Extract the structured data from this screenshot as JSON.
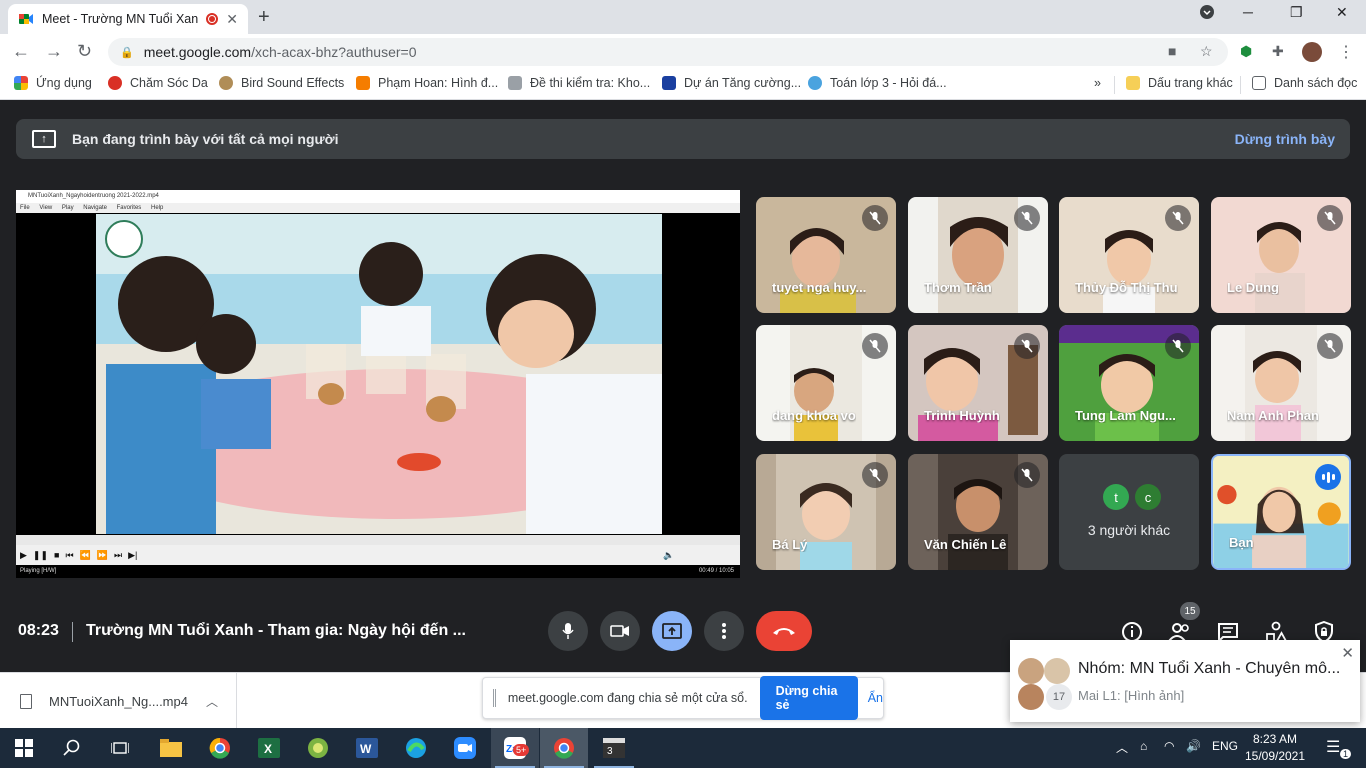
{
  "browser": {
    "tab_title": "Meet - Trường MN Tuổi Xanh",
    "url_host": "meet.google.com",
    "url_path": "/xch-acax-bhz?authuser=0",
    "bookmarks": [
      {
        "label": "Ứng dụng"
      },
      {
        "label": "Chăm Sóc Da"
      },
      {
        "label": "Bird Sound Effects"
      },
      {
        "label": "Phạm Hoan: Hình đ..."
      },
      {
        "label": "Đề thi kiểm tra: Kho..."
      },
      {
        "label": "Dự án Tăng cường..."
      },
      {
        "label": "Toán lớp 3 - Hỏi đá..."
      },
      {
        "label": "»"
      },
      {
        "label": "Dấu trang khác"
      },
      {
        "label": "Danh sách đọc"
      }
    ]
  },
  "meet": {
    "banner_text": "Bạn đang trình bày với tất cả mọi người",
    "stop_label": "Dừng trình bày",
    "time": "08:23",
    "meeting_title": "Trường MN Tuổi Xanh - Tham gia: Ngày hội đến ...",
    "participant_count": "15",
    "player": {
      "window_title": "MNTuoiXanh_Ngayhoidentruong 2021-2022.mp4",
      "menu": [
        "File",
        "View",
        "Play",
        "Navigate",
        "Favorites",
        "Help"
      ],
      "status": "Playing [H/W]",
      "timecode": "00:49 / 10:05"
    },
    "participants": [
      {
        "name": "tuyet nga huy...",
        "bg": "#c9b79c",
        "skin": "#e6b89a"
      },
      {
        "name": "Thơm Trần",
        "bg": "#f2f2ef",
        "skin": "#d9a27f"
      },
      {
        "name": "Thủy Đỗ Thị Thu",
        "bg": "#e8dccc",
        "skin": "#f0c8a8"
      },
      {
        "name": "Le Dung",
        "bg": "#f2d9d2",
        "skin": "#eac0a0"
      },
      {
        "name": "dang khoa vo",
        "bg": "#f4f4f0",
        "skin": "#d8a67f"
      },
      {
        "name": "Trinh Huỳnh",
        "bg": "#d4c6c0",
        "skin": "#f0c6a8"
      },
      {
        "name": "Tung Lam Ngu...",
        "bg": "#4fa03e",
        "skin": "#f1c9a6"
      },
      {
        "name": "Nam Anh Phan",
        "bg": "#f4f2ee",
        "skin": "#efc6a7"
      },
      {
        "name": "Bá Lý",
        "bg": "#b8a995",
        "skin": "#f2cdb2"
      },
      {
        "name": "Văn Chiến Lê",
        "bg": "#6d625a",
        "skin": "#c8906b"
      }
    ],
    "others": {
      "label": "3 người khác",
      "initials": [
        "t",
        "c"
      ]
    },
    "self_name": "Bạn"
  },
  "download": {
    "filename": "MNTuoiXanh_Ng....mp4",
    "share_text": "meet.google.com đang chia sẻ một cửa sổ.",
    "share_button": "Dừng chia sẻ",
    "hide_label": "Ẩn"
  },
  "notification": {
    "title": "Nhóm: MN Tuổi Xanh - Chuyên mô...",
    "message": "Mai L1: [Hình ảnh]",
    "badge": "17"
  },
  "taskbar": {
    "language": "ENG",
    "time": "8:23 AM",
    "date": "15/09/2021",
    "zalo_badge": "5+",
    "notif_count": "1"
  },
  "colors": {
    "meet_bg": "#202124",
    "tile_bg": "#3c4043",
    "accent_blue": "#8ab4f8",
    "end_call_red": "#ea4335"
  }
}
